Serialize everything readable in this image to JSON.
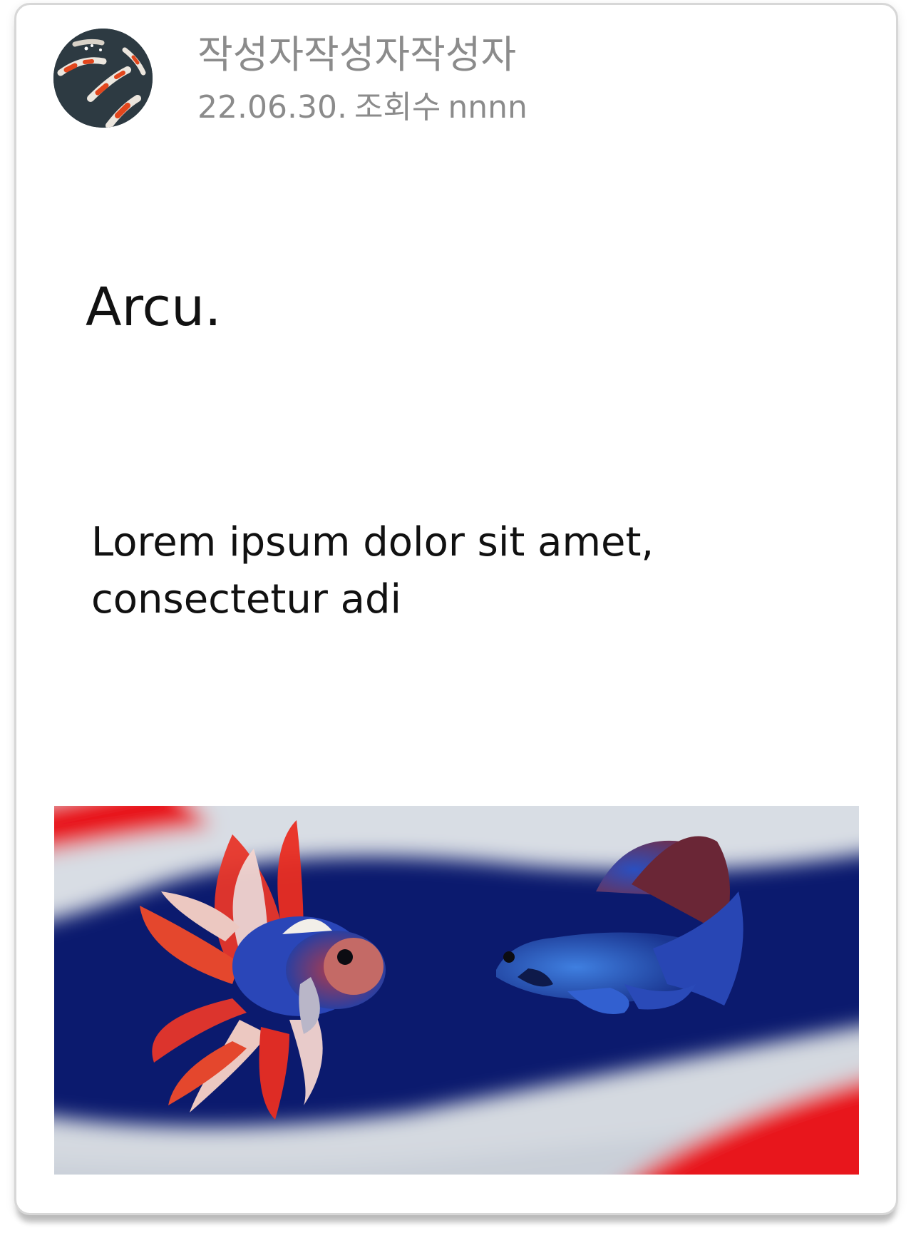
{
  "post": {
    "author_name": "작성자작성자작성자",
    "date": "22.06.30.",
    "views_label": "조회수",
    "views_value": "nnnn",
    "title": "Arcu.",
    "body": "Lorem ipsum dolor sit amet, consectetur adi"
  },
  "avatar": {
    "icon": "koi-fish-photo"
  },
  "image": {
    "icon": "betta-fish-photo"
  },
  "colors": {
    "meta_text": "#8b8b8b",
    "title_text": "#111111",
    "card_border": "#d7d7d7",
    "flag_blue": "#0b1a6e",
    "flag_red": "#e8141c"
  }
}
